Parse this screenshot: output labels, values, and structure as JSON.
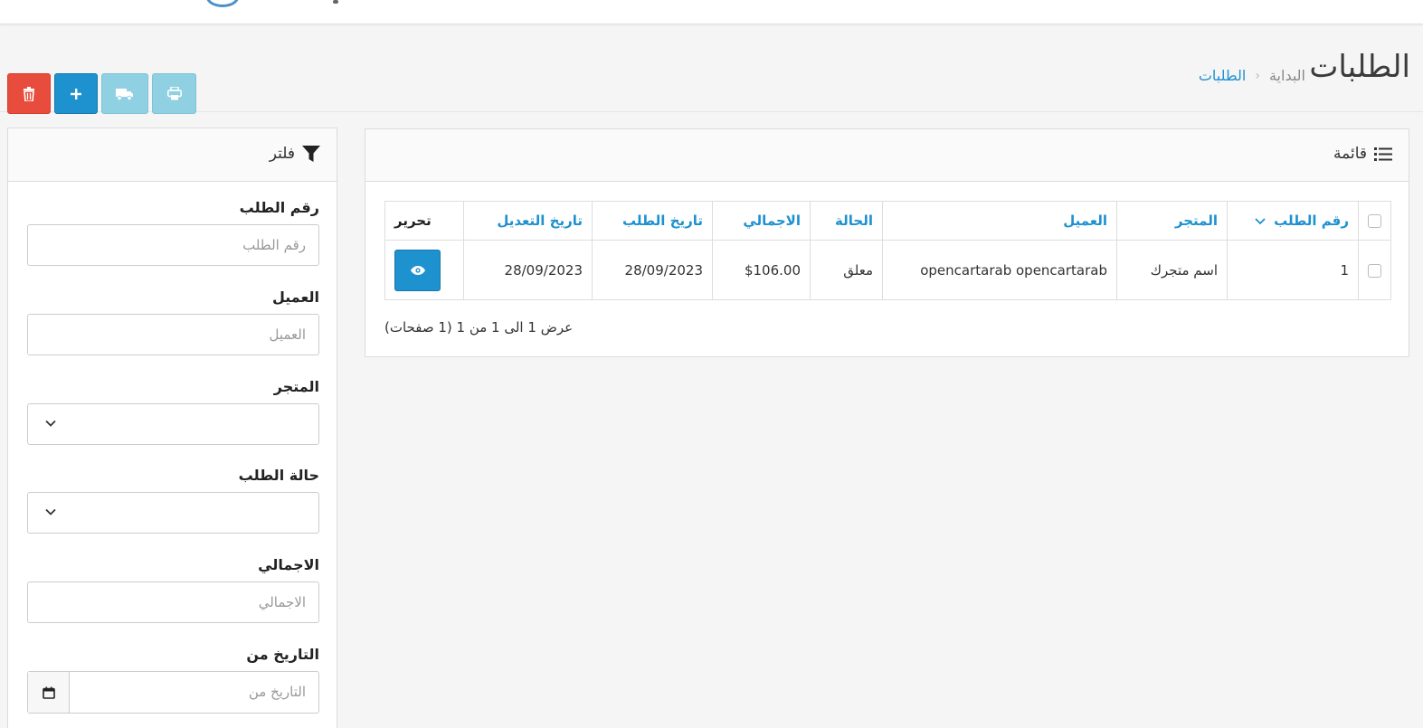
{
  "header": {
    "title": "الطلبات",
    "breadcrumb": {
      "home": "البداية",
      "separator": "‹",
      "current": "الطلبات"
    }
  },
  "toolbar": {
    "buttons": [
      {
        "name": "delete",
        "icon": "trash-icon",
        "color": "#e74c3c"
      },
      {
        "name": "add",
        "icon": "plus-icon",
        "color": "#1e91cf"
      },
      {
        "name": "shipping",
        "icon": "truck-icon",
        "color": "#90d0e3"
      },
      {
        "name": "print",
        "icon": "print-icon",
        "color": "#90d0e3"
      }
    ]
  },
  "list": {
    "title": "قائمة",
    "columns": {
      "order_id": "رقم الطلب",
      "store": "المتجر",
      "customer": "العميل",
      "status": "الحالة",
      "total": "الاجمالي",
      "date_added": "تاريخ الطلب",
      "date_modified": "تاريخ التعديل",
      "action": "تحرير"
    },
    "rows": [
      {
        "order_id": "1",
        "store": "اسم متجرك",
        "customer": "opencartarab opencartarab",
        "status": "معلق",
        "total": "$106.00",
        "date_added": "28/09/2023",
        "date_modified": "28/09/2023"
      }
    ],
    "pagination_text": "عرض 1 الى 1 من 1 (1 صفحات)"
  },
  "filter": {
    "title": "فلتر",
    "fields": {
      "order_id": {
        "label": "رقم الطلب",
        "placeholder": "رقم الطلب"
      },
      "customer": {
        "label": "العميل",
        "placeholder": "العميل"
      },
      "store": {
        "label": "المتجر"
      },
      "order_status": {
        "label": "حالة الطلب"
      },
      "total": {
        "label": "الاجمالي",
        "placeholder": "الاجمالي"
      },
      "date_from": {
        "label": "التاريخ من",
        "placeholder": "التاريخ من"
      }
    }
  },
  "colors": {
    "primary": "#1e91cf",
    "danger": "#e74c3c",
    "info_light": "#90d0e3"
  }
}
